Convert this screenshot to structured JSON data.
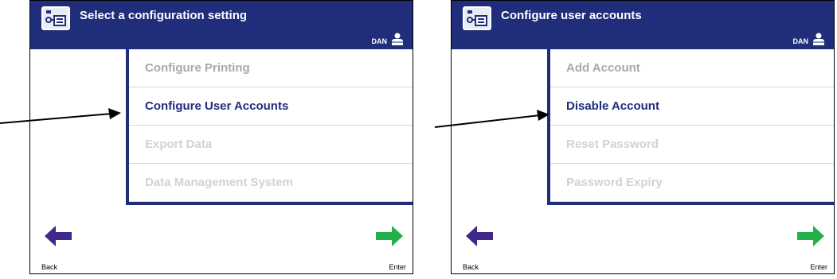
{
  "colors": {
    "header": "#1f2d7a",
    "back_arrow": "#3f2a8c",
    "enter_arrow": "#22b14c",
    "disabled_text": "#d2d2d2",
    "grey_text": "#a9a9a9"
  },
  "screens": [
    {
      "title": "Select a configuration setting",
      "user": "DAN",
      "menu": [
        {
          "label": "Configure Printing",
          "state": "enabled"
        },
        {
          "label": "Configure User Accounts",
          "state": "selected"
        },
        {
          "label": "Export Data",
          "state": "disabled"
        },
        {
          "label": "Data Management System",
          "state": "disabled"
        }
      ],
      "back_label": "Back",
      "enter_label": "Enter"
    },
    {
      "title": "Configure user accounts",
      "user": "DAN",
      "menu": [
        {
          "label": "Add Account",
          "state": "enabled"
        },
        {
          "label": "Disable Account",
          "state": "selected"
        },
        {
          "label": "Reset Password",
          "state": "disabled"
        },
        {
          "label": "Password Expiry",
          "state": "disabled"
        }
      ],
      "back_label": "Back",
      "enter_label": "Enter"
    }
  ]
}
